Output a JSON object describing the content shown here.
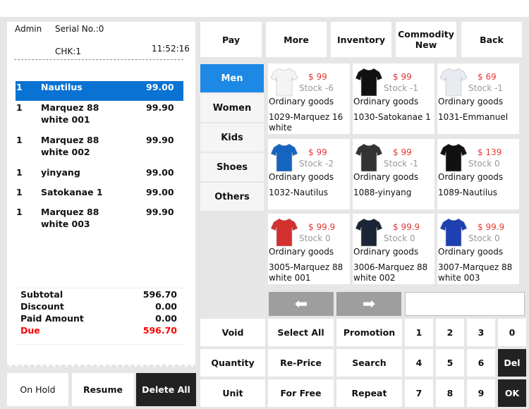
{
  "receipt": {
    "user": "Admin",
    "serial": "Serial No.:0",
    "checkout": "CHK:1",
    "time": "11:52:16",
    "items": [
      {
        "qty": "1",
        "name": "Nautilus",
        "price": "99.00",
        "selected": true
      },
      {
        "qty": "1",
        "name": "Marquez 88 white 001",
        "price": "99.90"
      },
      {
        "qty": "1",
        "name": "Marquez 88 white 002",
        "price": "99.90"
      },
      {
        "qty": "1",
        "name": "yinyang",
        "price": "99.00"
      },
      {
        "qty": "1",
        "name": "Satokanae 1",
        "price": "99.00"
      },
      {
        "qty": "1",
        "name": "Marquez 88 white 003",
        "price": "99.90"
      }
    ],
    "totals": {
      "subtotal_label": "Subtotal",
      "subtotal": "596.70",
      "discount_label": "Discount",
      "discount": "0.00",
      "paid_label": "Paid Amount",
      "paid": "0.00",
      "due_label": "Due",
      "due": "596.70"
    }
  },
  "bottom_left": {
    "hold": "On Hold",
    "resume": "Resume",
    "delete_all": "Delete All"
  },
  "toolbar": {
    "pay": "Pay",
    "more": "More",
    "inventory": "Inventory",
    "commodity_new": "Commodity New",
    "back": "Back"
  },
  "categories": [
    {
      "label": "Men",
      "active": true
    },
    {
      "label": "Women"
    },
    {
      "label": "Kids"
    },
    {
      "label": "Shoes"
    },
    {
      "label": "Others"
    }
  ],
  "products": [
    {
      "price": "$ 99",
      "stock": "Stock -6",
      "type": "Ordinary goods",
      "name": "1029-Marquez 16 white",
      "color": "#f4f4f4"
    },
    {
      "price": "$ 99",
      "stock": "Stock -1",
      "type": "Ordinary goods",
      "name": "1030-Satokanae 1",
      "color": "#111111"
    },
    {
      "price": "$ 69",
      "stock": "Stock -1",
      "type": "Ordinary goods",
      "name": "1031-Emmanuel",
      "color": "#e8ecf0"
    },
    {
      "price": "$ 99",
      "stock": "Stock -2",
      "type": "Ordinary goods",
      "name": "1032-Nautilus",
      "color": "#1565c0"
    },
    {
      "price": "$ 99",
      "stock": "Stock -1",
      "type": "Ordinary goods",
      "name": "1088-yinyang",
      "color": "#333333"
    },
    {
      "price": "$ 139",
      "stock": "Stock 0",
      "type": "Ordinary goods",
      "name": "1089-Nautilus",
      "color": "#111111"
    },
    {
      "price": "$ 99.9",
      "stock": "Stock 0",
      "type": "Ordinary goods",
      "name": "3005-Marquez 88 white 001",
      "color": "#d32f2f"
    },
    {
      "price": "$ 99.9",
      "stock": "Stock 0",
      "type": "Ordinary goods",
      "name": "3006-Marquez 88 white 002",
      "color": "#1a2535"
    },
    {
      "price": "$ 99.9",
      "stock": "Stock 0",
      "type": "Ordinary goods",
      "name": "3007-Marquez 88 white 003",
      "color": "#1e40b0"
    }
  ],
  "pager": {
    "prev": "⬅",
    "next": "➡",
    "input_value": ""
  },
  "actions": {
    "void": "Void",
    "quantity": "Quantity",
    "unit": "Unit",
    "select_all": "Select All",
    "reprice": "Re-Price",
    "for_free": "For Free",
    "promotion": "Promotion",
    "search": "Search",
    "repeat": "Repeat",
    "del": "Del",
    "ok": "OK"
  },
  "keypad": [
    "1",
    "2",
    "3",
    "0",
    "4",
    "5",
    "6",
    "7",
    "8",
    "9"
  ]
}
